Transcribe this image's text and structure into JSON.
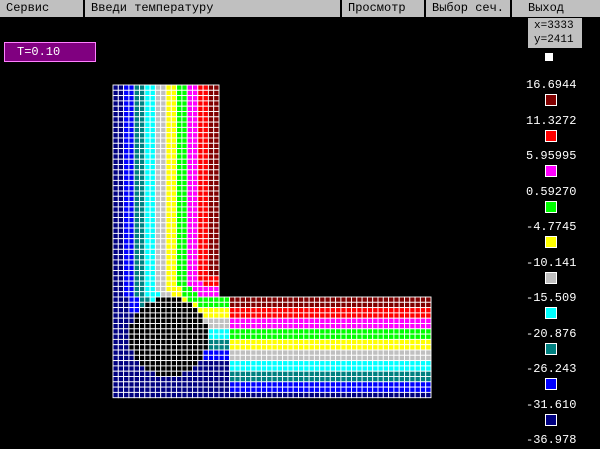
{
  "menu": [
    {
      "label": "Сервис"
    },
    {
      "label": "Введи температуру"
    },
    {
      "label": "Просмотр"
    },
    {
      "label": "Выбор сеч."
    },
    {
      "label": "Выход"
    }
  ],
  "cursor": {
    "x": "x=3333",
    "y": "y=2411"
  },
  "time_label": "T=0.10",
  "legend": {
    "top_swatch": "#ffffff",
    "values": [
      "16.6944",
      "11.3272",
      "5.95995",
      "0.59270",
      "-4.7745",
      "-10.141",
      "-15.509",
      "-20.876",
      "-26.243",
      "-31.610",
      "-36.978"
    ],
    "swatches": [
      "#800000",
      "#ff0000",
      "#ff00ff",
      "#00ff00",
      "#ffff00",
      "#c0c0c0",
      "#00ffff",
      "#008080",
      "#0000ff",
      "#000080"
    ]
  },
  "colors": {
    "grid_line": "#ffffff",
    "hole": "#000000",
    "background": "#000000"
  }
}
